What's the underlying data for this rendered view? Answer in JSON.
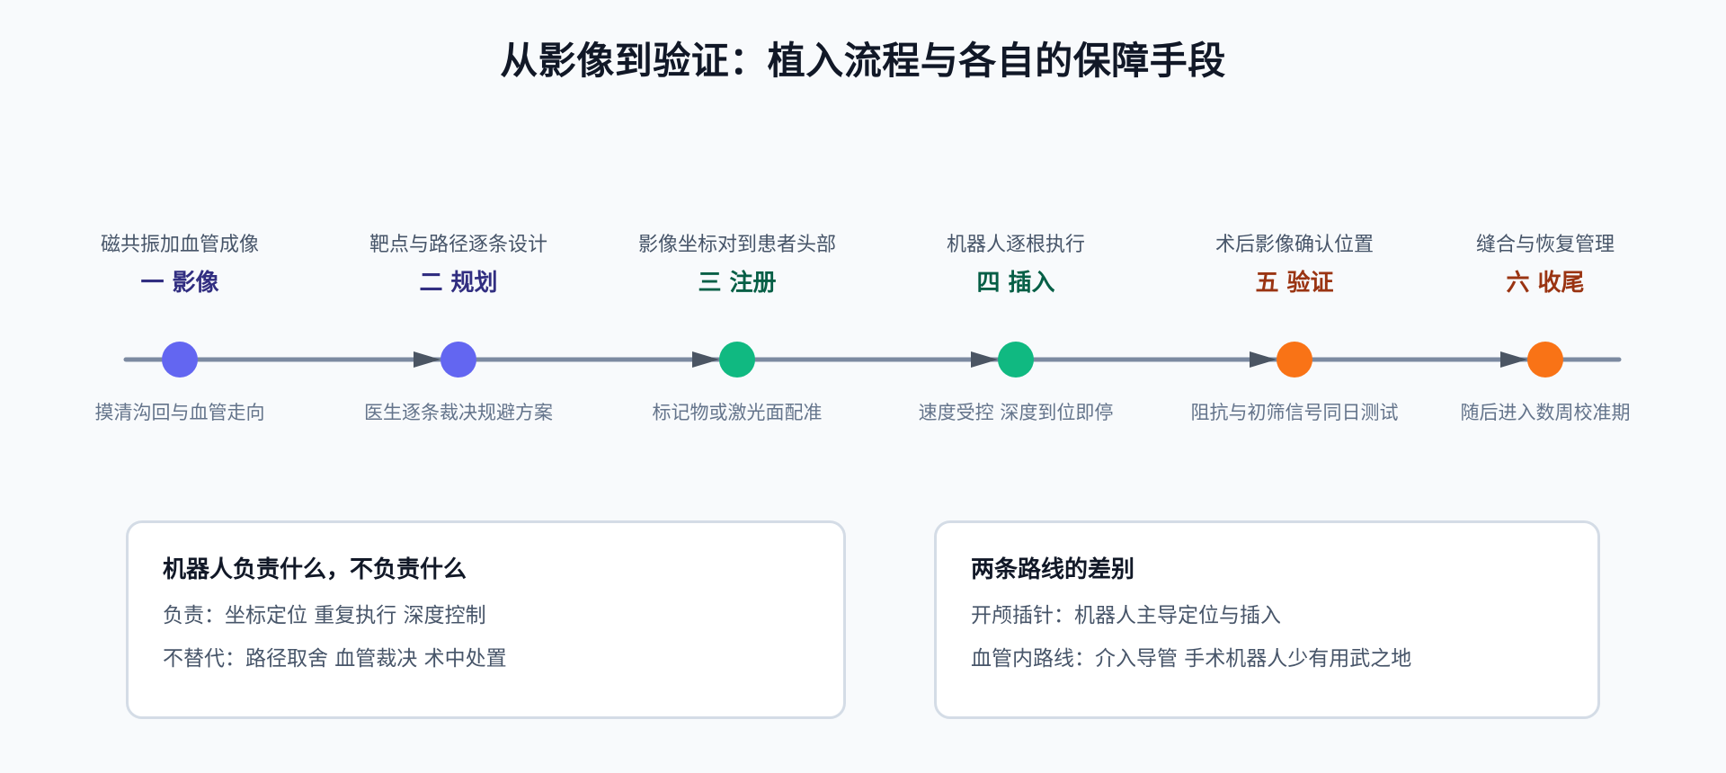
{
  "title": "从影像到验证：植入流程与各自的保障手段",
  "colors": {
    "line": "#7c8aa1",
    "arrow": "#4b5563",
    "step1": "#6366f1",
    "step2": "#10b981",
    "step3": "#f97316",
    "label1": "#312e81",
    "label2": "#065f46",
    "label3": "#9a3412"
  },
  "steps": [
    {
      "top": "磁共振加血管成像",
      "name": "一 影像",
      "bottom": "摸清沟回与血管走向",
      "color": "#6366f1",
      "label_color": "#312e81"
    },
    {
      "top": "靶点与路径逐条设计",
      "name": "二 规划",
      "bottom": "医生逐条裁决规避方案",
      "color": "#6366f1",
      "label_color": "#312e81"
    },
    {
      "top": "影像坐标对到患者头部",
      "name": "三 注册",
      "bottom": "标记物或激光面配准",
      "color": "#10b981",
      "label_color": "#065f46"
    },
    {
      "top": "机器人逐根执行",
      "name": "四 插入",
      "bottom": "速度受控 深度到位即停",
      "color": "#10b981",
      "label_color": "#065f46"
    },
    {
      "top": "术后影像确认位置",
      "name": "五 验证",
      "bottom": "阻抗与初筛信号同日测试",
      "color": "#f97316",
      "label_color": "#9a3412"
    },
    {
      "top": "缝合与恢复管理",
      "name": "六 收尾",
      "bottom": "随后进入数周校准期",
      "color": "#f97316",
      "label_color": "#9a3412"
    }
  ],
  "panels": {
    "left": {
      "title": "机器人负责什么，不负责什么",
      "line1": "负责：坐标定位 重复执行 深度控制",
      "line2": "不替代：路径取舍 血管裁决 术中处置"
    },
    "right": {
      "title": "两条路线的差别",
      "line1": "开颅插针：机器人主导定位与插入",
      "line2": "血管内路线：介入导管 手术机器人少有用武之地"
    }
  }
}
